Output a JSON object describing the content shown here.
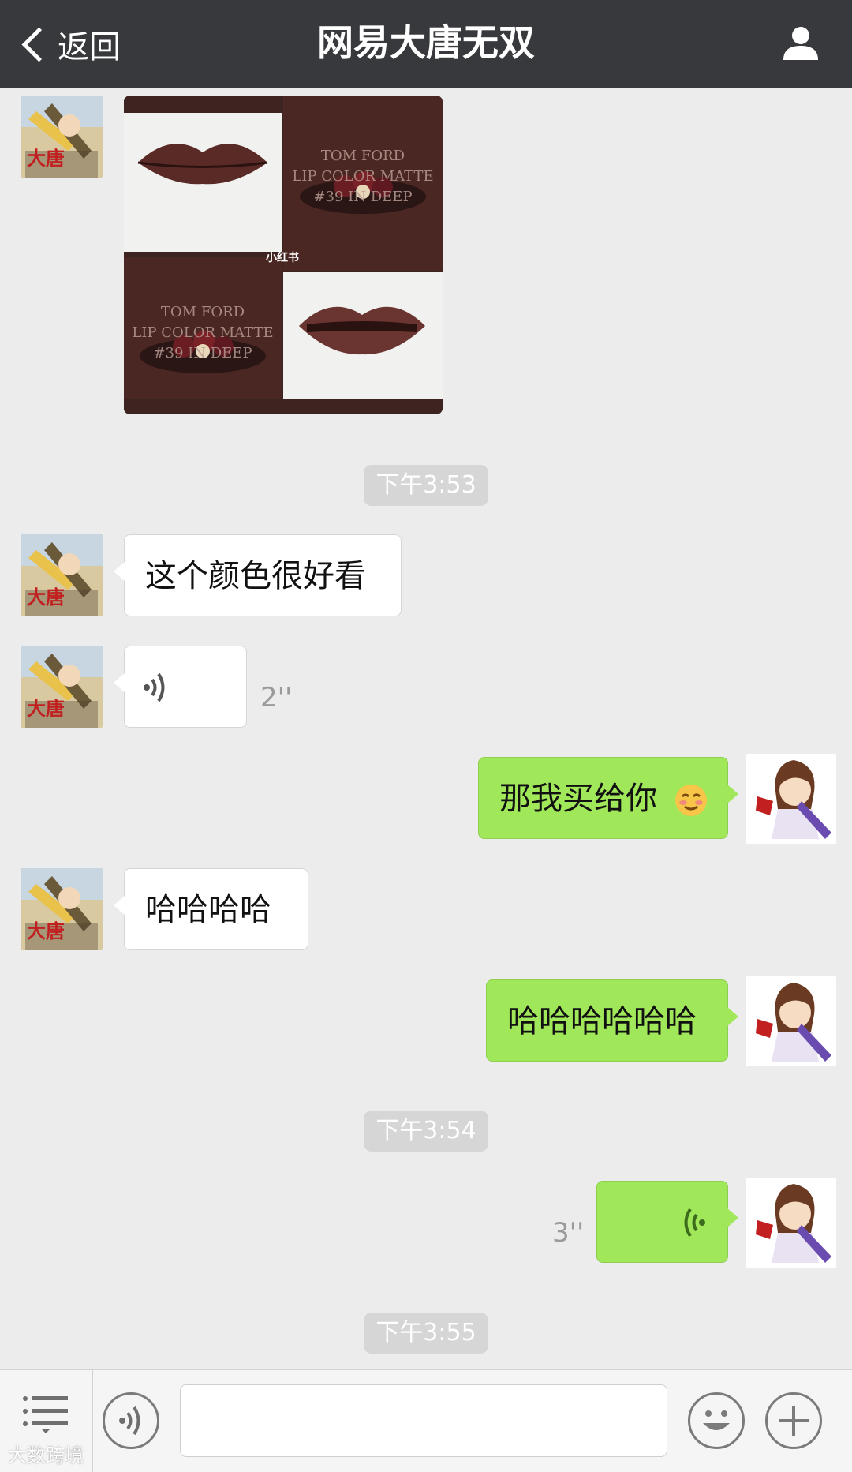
{
  "header": {
    "back_label": "返回",
    "title": "网易大唐无双"
  },
  "image_message": {
    "brand_text": [
      "TOM FORD",
      "LIP COLOR MATTE",
      "#39 IN DEEP"
    ],
    "source_tag": "小红书"
  },
  "timestamps": [
    "下午3:53",
    "下午3:54",
    "下午3:55"
  ],
  "messages": [
    {
      "side": "left",
      "type": "text",
      "text": "这个颜色很好看"
    },
    {
      "side": "left",
      "type": "voice",
      "duration": "2''"
    },
    {
      "side": "right",
      "type": "text",
      "text": "那我买给你"
    },
    {
      "side": "left",
      "type": "text",
      "text": "哈哈哈哈"
    },
    {
      "side": "right",
      "type": "text",
      "text": "哈哈哈哈哈哈"
    },
    {
      "side": "right",
      "type": "voice",
      "duration": "3''"
    }
  ],
  "watermark": "大数跨境",
  "colors": {
    "header_bg": "#38393d",
    "chat_bg": "#ececec",
    "sent_bubble": "#a0e75a",
    "received_bubble": "#ffffff"
  },
  "icons": {
    "back": "chevron-left-icon",
    "profile": "person-icon",
    "menu": "menu-icon",
    "voice": "voice-icon",
    "emoji": "smiley-icon",
    "plus": "plus-icon"
  }
}
